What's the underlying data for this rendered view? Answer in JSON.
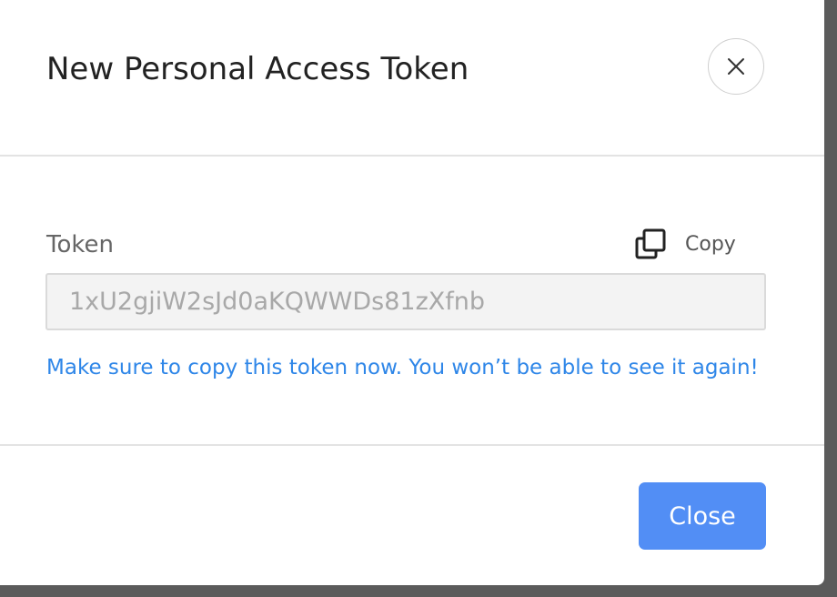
{
  "modal": {
    "title": "New Personal Access Token",
    "close_icon": "close-x-icon"
  },
  "token_field": {
    "label": "Token",
    "value": "1xU2gjiW2sJd0aKQWWDs81zXfnb",
    "copy_label": "Copy",
    "copy_icon": "copy-icon"
  },
  "warning": "Make sure to copy this token now. You won’t be able to see it again!",
  "footer": {
    "close_button_label": "Close"
  },
  "colors": {
    "accent_button": "#528ef5",
    "warning_text": "#2e86e8",
    "overlay": "#5b5b5b"
  }
}
